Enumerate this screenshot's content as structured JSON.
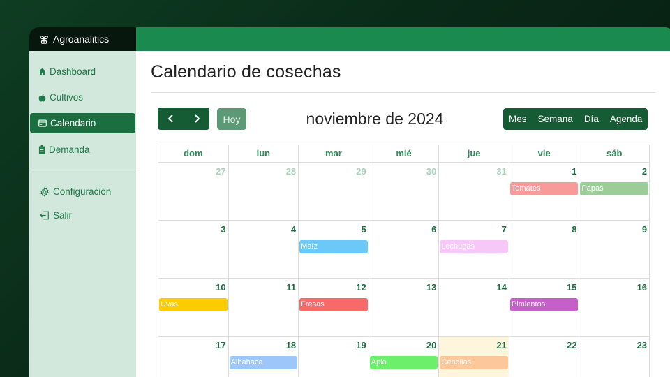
{
  "app": {
    "name": "Agroanalitics"
  },
  "sidebar": {
    "items": [
      {
        "label": "Dashboard",
        "icon": "home-icon",
        "active": false
      },
      {
        "label": "Cultivos",
        "icon": "apple-icon",
        "active": false
      },
      {
        "label": "Calendario",
        "icon": "calendar-icon",
        "active": true
      },
      {
        "label": "Demanda",
        "icon": "clipboard-icon",
        "active": false
      }
    ],
    "secondary": [
      {
        "label": "Configuración",
        "icon": "gear-icon"
      },
      {
        "label": "Salir",
        "icon": "logout-icon"
      }
    ]
  },
  "page": {
    "title": "Calendario de cosechas"
  },
  "toolbar": {
    "prev": "‹",
    "next": "›",
    "today": "Hoy",
    "month": "noviembre de 2024",
    "views": [
      "Mes",
      "Semana",
      "Día",
      "Agenda"
    ]
  },
  "calendar": {
    "days_of_week": [
      "dom",
      "lun",
      "mar",
      "mié",
      "jue",
      "vie",
      "sáb"
    ],
    "weeks": [
      [
        {
          "day": "27",
          "other": true
        },
        {
          "day": "28",
          "other": true
        },
        {
          "day": "29",
          "other": true
        },
        {
          "day": "30",
          "other": true
        },
        {
          "day": "31",
          "other": true
        },
        {
          "day": "1",
          "event": "Tomates",
          "color": "#f89a9a"
        },
        {
          "day": "2",
          "event": "Papas",
          "color": "#9ccd99"
        }
      ],
      [
        {
          "day": "3"
        },
        {
          "day": "4"
        },
        {
          "day": "5",
          "event": "Maíz",
          "color": "#6cc8f7"
        },
        {
          "day": "6"
        },
        {
          "day": "7",
          "event": "Lechugas",
          "color": "#f7c8f7"
        },
        {
          "day": "8"
        },
        {
          "day": "9"
        }
      ],
      [
        {
          "day": "10",
          "event": "Uvas",
          "color": "#fccb00"
        },
        {
          "day": "11"
        },
        {
          "day": "12",
          "event": "Fresas",
          "color": "#f86a6a"
        },
        {
          "day": "13"
        },
        {
          "day": "14"
        },
        {
          "day": "15",
          "event": "Pimientos",
          "color": "#c65fc9"
        },
        {
          "day": "16"
        }
      ],
      [
        {
          "day": "17"
        },
        {
          "day": "18",
          "event": "Albahaca",
          "color": "#9dc7fa"
        },
        {
          "day": "19"
        },
        {
          "day": "20",
          "event": "Apio",
          "color": "#6cf06c"
        },
        {
          "day": "21",
          "event": "Cebollas",
          "color": "#fcc89a",
          "today": true
        },
        {
          "day": "22"
        },
        {
          "day": "23"
        }
      ]
    ]
  },
  "colors": {
    "brand": "#1a8a4f",
    "sidebar": "#d2e8dc",
    "active": "#1a6e3f",
    "today": "#fdf6dc"
  }
}
